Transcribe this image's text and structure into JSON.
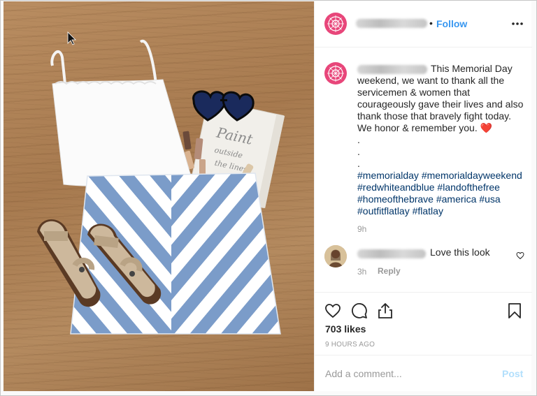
{
  "post": {
    "follow_separator": "•",
    "follow_label": "Follow",
    "more_icon": "more-options-icon",
    "caption_lines": [
      "This Memorial Day",
      "weekend, we want to thank all the",
      "servicemen & women that",
      "courageously gave their lives and also",
      "thank those that bravely fight today.",
      "We honor & remember you."
    ],
    "caption_emoji": "❤️",
    "caption_dots": [
      ".",
      ".",
      "."
    ],
    "hashtag_lines": [
      "#memorialday #memorialdayweekend",
      "#redwhiteandblue #landofthefree",
      "#homeofthebrave #america #usa",
      "#outfitflatlay #flatlay"
    ],
    "caption_time": "9h",
    "brand_color": "#e8467a",
    "link_color": "#3897f0",
    "hashtag_color": "#003569"
  },
  "comment": {
    "text": "Love this look",
    "time": "3h",
    "reply_label": "Reply"
  },
  "actions": {
    "icons": [
      "heart-icon",
      "comment-icon",
      "share-icon",
      "bookmark-icon"
    ],
    "likes": "703 likes",
    "time_ago": "9 HOURS AGO"
  },
  "comment_form": {
    "placeholder": "Add a comment...",
    "post_label": "Post"
  }
}
